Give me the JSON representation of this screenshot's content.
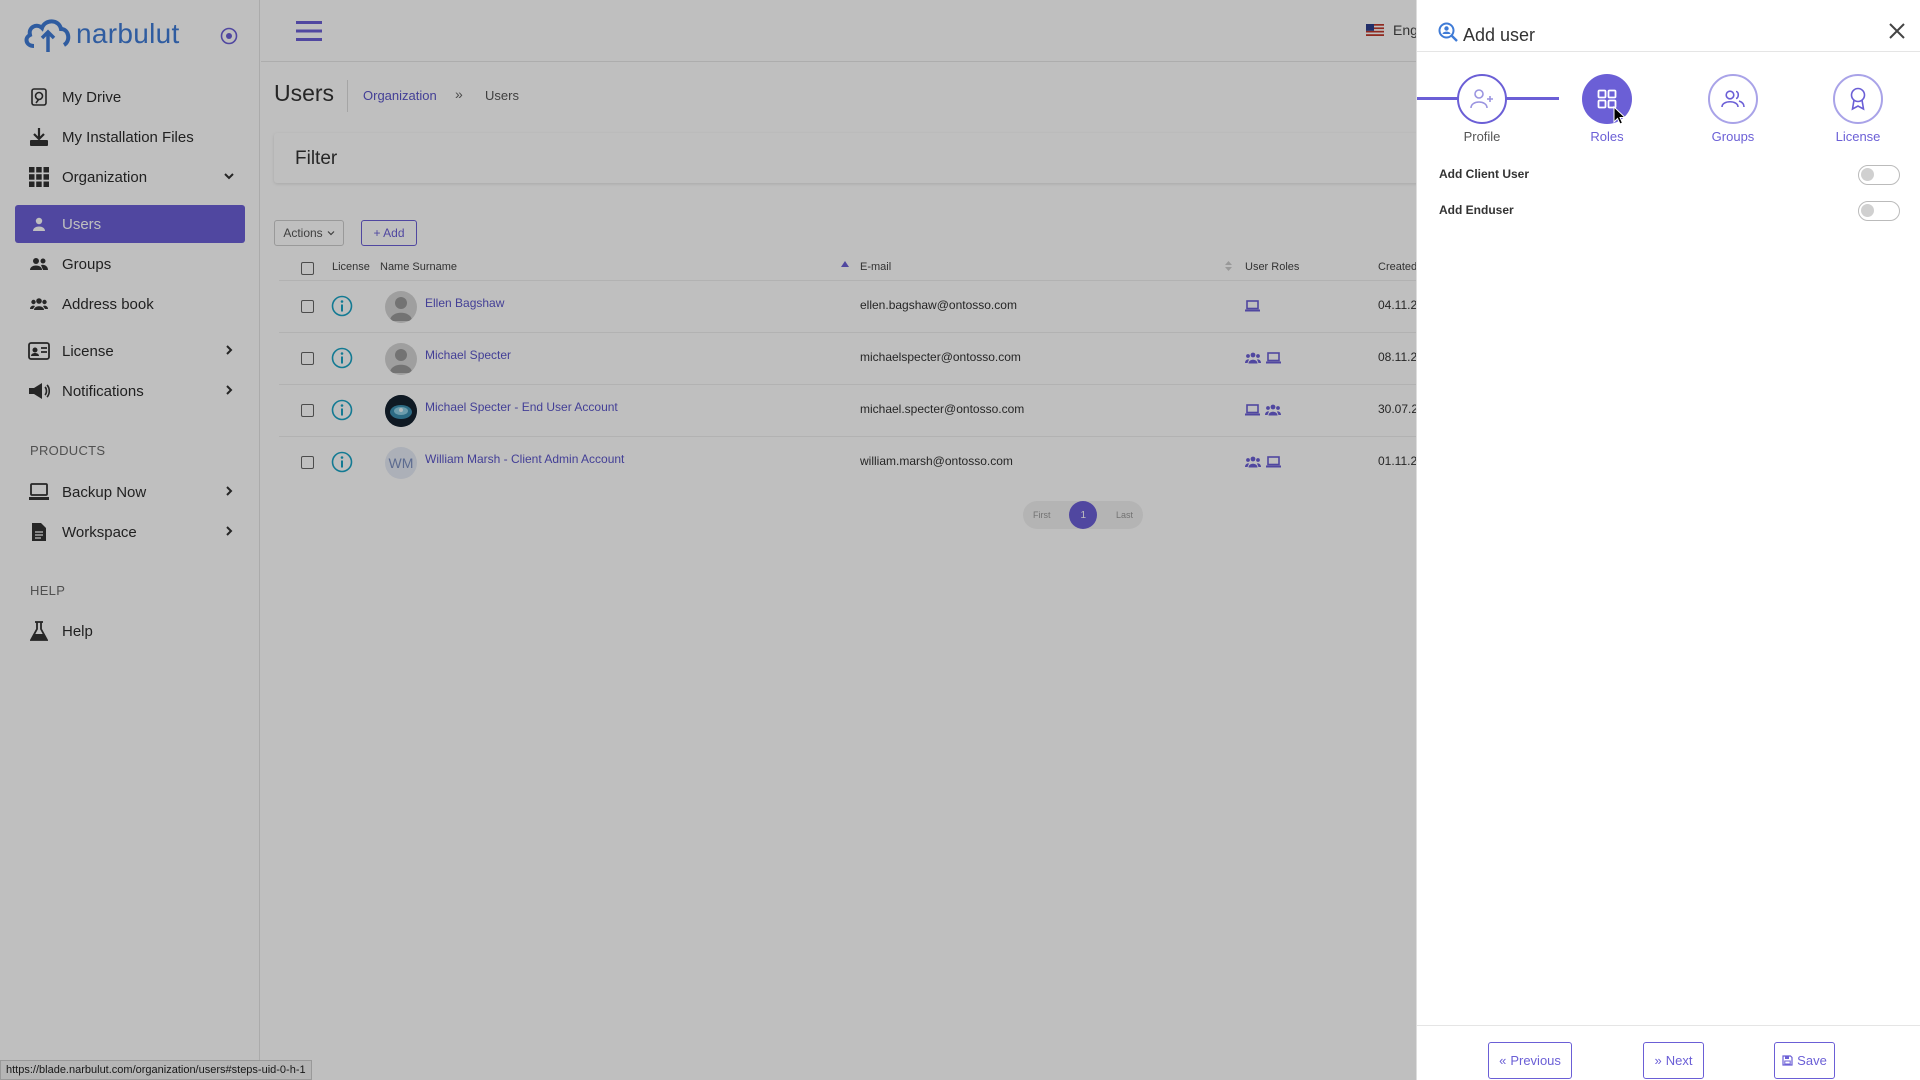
{
  "brand": {
    "name": "narbulut"
  },
  "sidebar": {
    "items": [
      {
        "label": "My Drive",
        "icon": "drive-icon"
      },
      {
        "label": "My Installation Files",
        "icon": "download-icon"
      },
      {
        "label": "Organization",
        "icon": "grid-icon",
        "expanded": true
      },
      {
        "label": "Users",
        "icon": "user-icon",
        "active": true
      },
      {
        "label": "Groups",
        "icon": "users-icon"
      },
      {
        "label": "Address book",
        "icon": "address-book-icon"
      },
      {
        "label": "License",
        "icon": "id-card-icon"
      },
      {
        "label": "Notifications",
        "icon": "megaphone-icon"
      },
      {
        "label": "Backup Now",
        "icon": "server-icon"
      },
      {
        "label": "Workspace",
        "icon": "file-icon"
      },
      {
        "label": "Help",
        "icon": "flask-icon"
      }
    ],
    "sections": {
      "products": "PRODUCTS",
      "help": "HELP"
    }
  },
  "topbar": {
    "language": "Eng"
  },
  "page": {
    "title": "Users",
    "breadcrumb": [
      "Organization",
      "Users"
    ],
    "filter_title": "Filter",
    "actions_label": "Actions",
    "add_label": "+ Add"
  },
  "table": {
    "columns": [
      "License",
      "Name Surname",
      "E-mail",
      "User Roles",
      "Created"
    ],
    "rows": [
      {
        "name": "Ellen Bagshaw",
        "email": "ellen.bagshaw@ontosso.com",
        "created": "04.11.2",
        "avatar": "placeholder"
      },
      {
        "name": "Michael Specter",
        "email": "michaelspecter@ontosso.com",
        "created": "08.11.2",
        "avatar": "placeholder"
      },
      {
        "name": "Michael Specter - End User Account",
        "email": "michael.specter@ontosso.com",
        "created": "30.07.2",
        "avatar": "photo"
      },
      {
        "name": "William Marsh - Client Admin Account",
        "email": "william.marsh@ontosso.com",
        "created": "01.11.2",
        "avatar": "initials",
        "initials": "WM"
      }
    ]
  },
  "pagination": {
    "first": "First",
    "current": "1",
    "last": "Last"
  },
  "status_url": "https://blade.narbulut.com/organization/users#steps-uid-0-h-1",
  "drawer": {
    "title": "Add user",
    "steps": [
      {
        "label": "Profile",
        "state": "done"
      },
      {
        "label": "Roles",
        "state": "active"
      },
      {
        "label": "Groups",
        "state": "todo"
      },
      {
        "label": "License",
        "state": "todo"
      }
    ],
    "toggles": [
      {
        "label": "Add Client User",
        "on": false
      },
      {
        "label": "Add Enduser",
        "on": false
      }
    ],
    "buttons": {
      "previous": "Previous",
      "next": "Next",
      "save": "Save"
    }
  },
  "colors": {
    "accent": "#6b5fd6",
    "brand": "#3f7bd6",
    "info": "#1aa3c4"
  }
}
